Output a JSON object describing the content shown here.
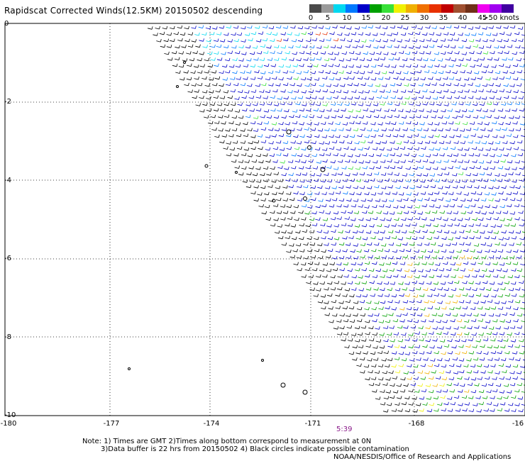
{
  "title": "Rapidscat Corrected Winds(12.5KM) 20150502 descending",
  "legend": {
    "colors": [
      "#4a4a4a",
      "#9a9a9a",
      "#00d8f0",
      "#0078ff",
      "#0000c8",
      "#00a000",
      "#38e038",
      "#f0f000",
      "#f0b000",
      "#f07000",
      "#e83000",
      "#c00000",
      "#a05030",
      "#703018",
      "#f000f0",
      "#a000f0",
      "#4000a0"
    ],
    "labels": [
      "0",
      "5",
      "10",
      "15",
      "20",
      "25",
      "30",
      "35",
      "40",
      "45",
      ">50 knots"
    ]
  },
  "map": {
    "x_ticks": [
      "-180",
      "-177",
      "-174",
      "-171",
      "-168",
      "-16"
    ],
    "y_ticks": [
      "0",
      "-2",
      "-4",
      "-6",
      "-8",
      "-10"
    ],
    "time_label": "5:39"
  },
  "notes": {
    "line1": "Note: 1) Times are GMT 2)Times along bottom correspond to measurement at 0N",
    "line2": "3)Data buffer is 22 hrs from 20150502 4) Black circles indicate possible contamination",
    "credit": "NOAA/NESDIS/Office of Research and Applications"
  }
}
